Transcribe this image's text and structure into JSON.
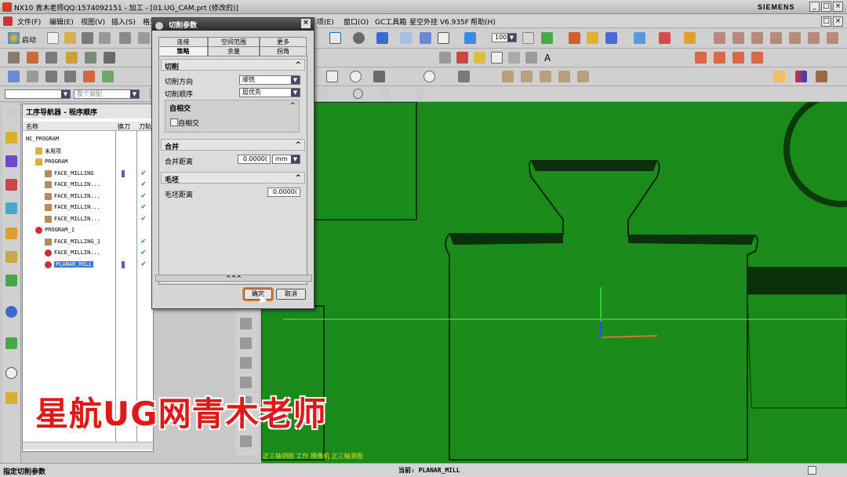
{
  "titlebar": {
    "title": "NX10 青木老师QQ:1574092151 - 加工 - [01.UG_CAM.prt (修改的)]",
    "brand": "SIEMENS"
  },
  "menubar": {
    "items": [
      "文件(F)",
      "编辑(E)",
      "视图(V)",
      "插入(S)",
      "格式",
      "项(E)",
      "窗口(O)",
      "GC工具箱",
      "星空外挂 V6.935F",
      "帮助(H)"
    ]
  },
  "toolbar": {
    "start_label": "启动",
    "zoom_value": "100",
    "snap_placeholder": "整个装配"
  },
  "navigator": {
    "title": "工序导航器 - 程序顺序",
    "columns": [
      "名称",
      "换刀",
      "刀轨"
    ],
    "rows": [
      {
        "label": "NC_PROGRAM",
        "indent": 0,
        "check": false,
        "tool": false,
        "icon": "none"
      },
      {
        "label": "未用项",
        "indent": 1,
        "check": false,
        "tool": false,
        "icon": "folder"
      },
      {
        "label": "PROGRAM",
        "indent": 1,
        "check": false,
        "tool": false,
        "icon": "folder-key"
      },
      {
        "label": "FACE_MILLING",
        "indent": 2,
        "check": true,
        "tool": true,
        "icon": "op"
      },
      {
        "label": "FACE_MILLIN...",
        "indent": 2,
        "check": true,
        "tool": false,
        "icon": "op"
      },
      {
        "label": "FACE_MILLIN...",
        "indent": 2,
        "check": true,
        "tool": false,
        "icon": "op"
      },
      {
        "label": "FACE_MILLIN...",
        "indent": 2,
        "check": true,
        "tool": false,
        "icon": "op"
      },
      {
        "label": "FACE_MILLIN...",
        "indent": 2,
        "check": true,
        "tool": false,
        "icon": "op"
      },
      {
        "label": "PROGRAM_1",
        "indent": 1,
        "check": false,
        "tool": false,
        "icon": "folder-no"
      },
      {
        "label": "FACE_MILLING_1",
        "indent": 2,
        "check": true,
        "tool": false,
        "icon": "op"
      },
      {
        "label": "FACE_MILLIN...",
        "indent": 2,
        "check": true,
        "tool": false,
        "icon": "op-no"
      },
      {
        "label": "PLANAR_MILL",
        "indent": 2,
        "check": true,
        "tool": true,
        "icon": "op-no",
        "selected": true
      }
    ]
  },
  "dialog": {
    "title": "切削参数",
    "tabs_row1": [
      "连接",
      "空间范围",
      "更多"
    ],
    "tabs_row2": [
      "策略",
      "余量",
      "拐角"
    ],
    "active_tab": "策略",
    "section_cut": "切削",
    "cut_direction_label": "切削方向",
    "cut_direction_value": "顺铣",
    "cut_order_label": "切削顺序",
    "cut_order_value": "层优先",
    "self_intersect_group": "自相交",
    "self_intersect_checkbox": "自相交",
    "section_merge": "合并",
    "merge_distance_label": "合并距离",
    "merge_distance_value": "0.0000(",
    "merge_unit": "mm",
    "section_blank": "毛坯",
    "blank_distance_label": "毛坯距离",
    "blank_distance_value": "0.0000(",
    "ok_label": "确定",
    "cancel_label": "取消"
  },
  "viewport": {
    "view_caption": "正三轴测图 工作 摄像机 正三轴测图"
  },
  "status": {
    "prompt": "指定切削参数",
    "current": "当前: PLANAR_MILL"
  },
  "watermark": "星航UG网青木老师",
  "colors": {
    "viewport_green": "#1a8a1a",
    "watermark_red": "#e01818",
    "selected_blue": "#3a78d8"
  }
}
